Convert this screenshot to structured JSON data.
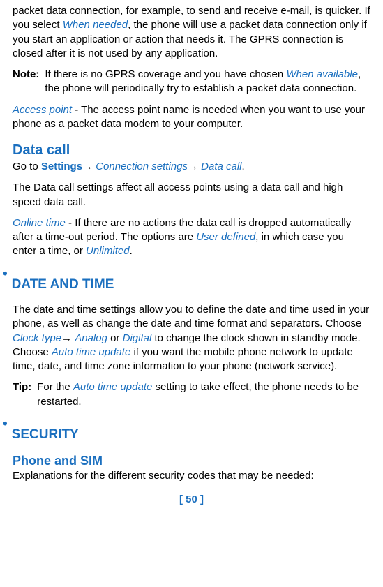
{
  "p1": {
    "a": "packet data connection, for example, to send and receive e-mail, is quicker. If you select ",
    "b": "When needed",
    "c": ", the phone will use a packet data connection only if you start an application or action that needs it. The GPRS connection is closed after it is not used by any application."
  },
  "note1": {
    "label": "Note:",
    "a": "If there is no GPRS coverage and you have chosen ",
    "b": "When available",
    "c": ", the phone will periodically try to establish a packet data connection."
  },
  "p2": {
    "a": "Access point",
    "b": " - The access point name is needed when you want to use your phone as a packet data modem to your computer."
  },
  "h_data_call": "Data call",
  "p3": {
    "a": "Go to ",
    "b": "Settings",
    "arr": "→ ",
    "c": "Connection settings",
    "d": "Data call",
    "e": "."
  },
  "p4": "The Data call settings affect all access points using a data call and high speed data call.",
  "p5": {
    "a": "Online time",
    "b": " - If there are no actions the data call is dropped automatically after a time-out period. The options are ",
    "c": "User defined",
    "d": ", in which case you enter a time, or ",
    "e": "Unlimited",
    "f": "."
  },
  "h_date": "DATE AND TIME",
  "p6": {
    "a": "The date and time settings allow you to define the date and time used in your phone, as well as change the date and time format and separators. Choose ",
    "b": "Clock type",
    "arr": "→ ",
    "c": "Analog",
    "d": " or ",
    "e": "Digital",
    "f": " to change the clock shown in standby mode.  Choose ",
    "g": "Auto time update",
    "h": " if you want the mobile phone network to update time, date, and time zone information to your phone (network service)."
  },
  "tip": {
    "label": "Tip:",
    "a": "For the ",
    "b": "Auto time update",
    "c": " setting to take effect, the phone needs to be restarted."
  },
  "h_security": "SECURITY",
  "h_phone_sim": "Phone and SIM",
  "p7": "Explanations for the different security codes that may be needed:",
  "pagenum": {
    "l": "[ ",
    "n": "50",
    "r": " ]"
  },
  "bullet": "•"
}
